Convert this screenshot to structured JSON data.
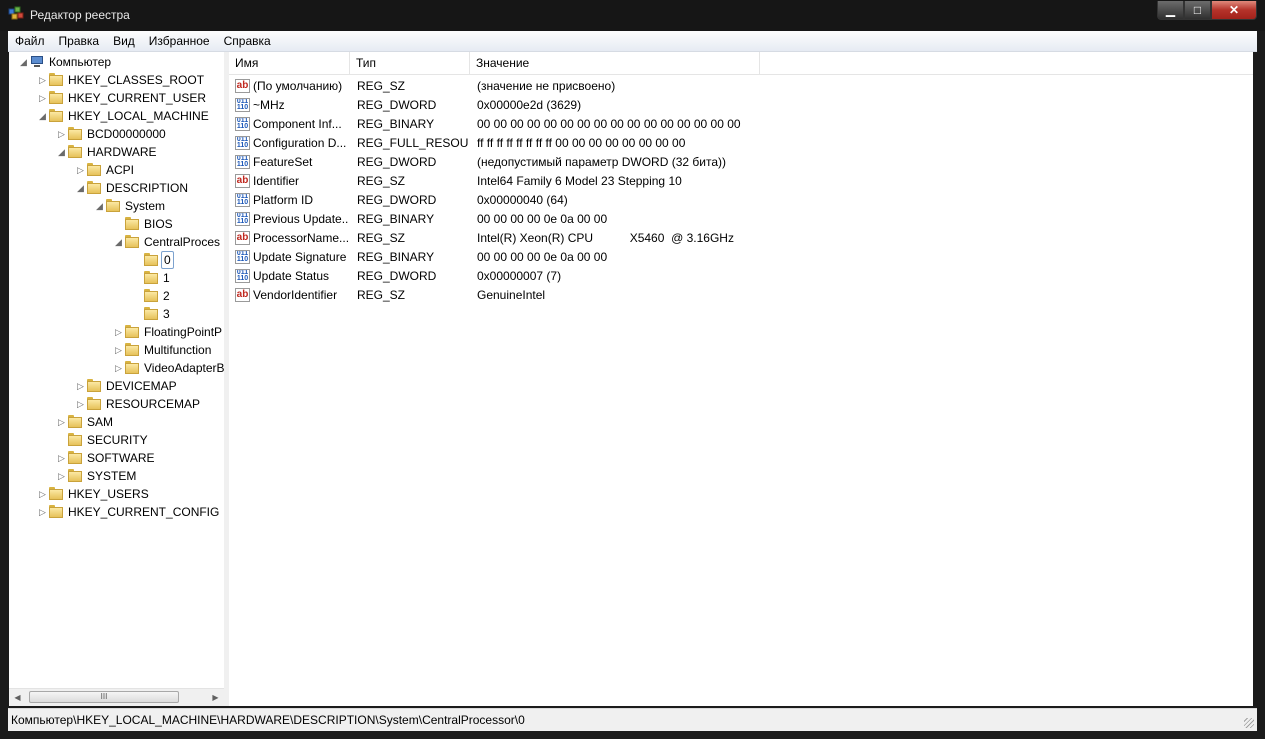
{
  "window": {
    "title": "Редактор реестра",
    "min_glyph": "▁",
    "max_glyph": "□",
    "close_glyph": "✕"
  },
  "menu": [
    "Файл",
    "Правка",
    "Вид",
    "Избранное",
    "Справка"
  ],
  "tree": [
    {
      "label": "Компьютер",
      "depth": 0,
      "state": "expanded",
      "icon": "computer-icon"
    },
    {
      "label": "HKEY_CLASSES_ROOT",
      "depth": 1,
      "state": "collapsed",
      "icon": "folder-icon"
    },
    {
      "label": "HKEY_CURRENT_USER",
      "depth": 1,
      "state": "collapsed",
      "icon": "folder-icon"
    },
    {
      "label": "HKEY_LOCAL_MACHINE",
      "depth": 1,
      "state": "expanded",
      "icon": "folder-icon"
    },
    {
      "label": "BCD00000000",
      "depth": 2,
      "state": "collapsed",
      "icon": "folder-icon"
    },
    {
      "label": "HARDWARE",
      "depth": 2,
      "state": "expanded",
      "icon": "folder-icon"
    },
    {
      "label": "ACPI",
      "depth": 3,
      "state": "collapsed",
      "icon": "folder-icon"
    },
    {
      "label": "DESCRIPTION",
      "depth": 3,
      "state": "expanded",
      "icon": "folder-icon"
    },
    {
      "label": "System",
      "depth": 4,
      "state": "expanded",
      "icon": "folder-icon"
    },
    {
      "label": "BIOS",
      "depth": 5,
      "state": "leaf",
      "icon": "folder-icon"
    },
    {
      "label": "CentralProces",
      "depth": 5,
      "state": "expanded",
      "icon": "folder-icon"
    },
    {
      "label": "0",
      "depth": 6,
      "state": "leaf",
      "icon": "folder-open-icon",
      "selected": true
    },
    {
      "label": "1",
      "depth": 6,
      "state": "leaf",
      "icon": "folder-icon"
    },
    {
      "label": "2",
      "depth": 6,
      "state": "leaf",
      "icon": "folder-icon"
    },
    {
      "label": "3",
      "depth": 6,
      "state": "leaf",
      "icon": "folder-icon"
    },
    {
      "label": "FloatingPointP",
      "depth": 5,
      "state": "collapsed",
      "icon": "folder-icon"
    },
    {
      "label": "Multifunction",
      "depth": 5,
      "state": "collapsed",
      "icon": "folder-icon"
    },
    {
      "label": "VideoAdapterB",
      "depth": 5,
      "state": "collapsed",
      "icon": "folder-icon"
    },
    {
      "label": "DEVICEMAP",
      "depth": 3,
      "state": "collapsed",
      "icon": "folder-icon"
    },
    {
      "label": "RESOURCEMAP",
      "depth": 3,
      "state": "collapsed",
      "icon": "folder-icon"
    },
    {
      "label": "SAM",
      "depth": 2,
      "state": "collapsed",
      "icon": "folder-icon"
    },
    {
      "label": "SECURITY",
      "depth": 2,
      "state": "leaf",
      "icon": "folder-icon"
    },
    {
      "label": "SOFTWARE",
      "depth": 2,
      "state": "collapsed",
      "icon": "folder-icon"
    },
    {
      "label": "SYSTEM",
      "depth": 2,
      "state": "collapsed",
      "icon": "folder-icon"
    },
    {
      "label": "HKEY_USERS",
      "depth": 1,
      "state": "collapsed",
      "icon": "folder-icon"
    },
    {
      "label": "HKEY_CURRENT_CONFIG",
      "depth": 1,
      "state": "collapsed",
      "icon": "folder-icon"
    }
  ],
  "tree_scroll": {
    "thumb_grip": "III"
  },
  "columns": [
    "Имя",
    "Тип",
    "Значение"
  ],
  "values": [
    {
      "name": "(По умолчанию)",
      "type": "REG_SZ",
      "data": "(значение не присвоено)",
      "icon": "string-value-icon"
    },
    {
      "name": "~MHz",
      "type": "REG_DWORD",
      "data": "0x00000e2d (3629)",
      "icon": "binary-value-icon"
    },
    {
      "name": "Component Inf...",
      "type": "REG_BINARY",
      "data": "00 00 00 00 00 00 00 00 00 00 00 00 00 00 00 00",
      "icon": "binary-value-icon"
    },
    {
      "name": "Configuration D...",
      "type": "REG_FULL_RESOU...",
      "data": "ff ff ff ff ff ff ff ff 00 00 00 00 00 00 00 00",
      "icon": "binary-value-icon"
    },
    {
      "name": "FeatureSet",
      "type": "REG_DWORD",
      "data": "(недопустимый параметр DWORD (32 бита))",
      "icon": "binary-value-icon"
    },
    {
      "name": "Identifier",
      "type": "REG_SZ",
      "data": "Intel64 Family 6 Model 23 Stepping 10",
      "icon": "string-value-icon"
    },
    {
      "name": "Platform ID",
      "type": "REG_DWORD",
      "data": "0x00000040 (64)",
      "icon": "binary-value-icon"
    },
    {
      "name": "Previous Update...",
      "type": "REG_BINARY",
      "data": "00 00 00 00 0e 0a 00 00",
      "icon": "binary-value-icon"
    },
    {
      "name": "ProcessorName...",
      "type": "REG_SZ",
      "data": "Intel(R) Xeon(R) CPU           X5460  @ 3.16GHz",
      "icon": "string-value-icon"
    },
    {
      "name": "Update Signature",
      "type": "REG_BINARY",
      "data": "00 00 00 00 0e 0a 00 00",
      "icon": "binary-value-icon"
    },
    {
      "name": "Update Status",
      "type": "REG_DWORD",
      "data": "0x00000007 (7)",
      "icon": "binary-value-icon"
    },
    {
      "name": "VendorIdentifier",
      "type": "REG_SZ",
      "data": "GenuineIntel",
      "icon": "string-value-icon"
    }
  ],
  "icon_glyphs": {
    "string": "ab",
    "binary": "011 110"
  },
  "status": "Компьютер\\HKEY_LOCAL_MACHINE\\HARDWARE\\DESCRIPTION\\System\\CentralProcessor\\0"
}
